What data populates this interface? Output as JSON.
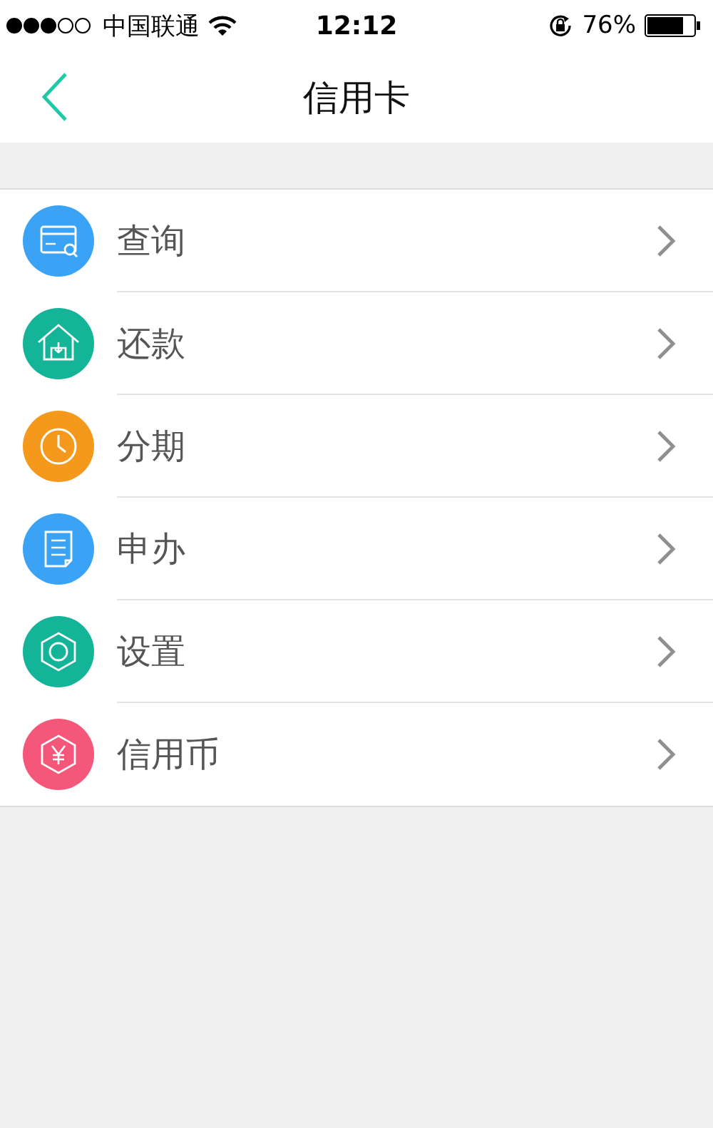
{
  "status_bar": {
    "carrier": "中国联通",
    "time": "12:12",
    "battery": "76%"
  },
  "nav": {
    "title": "信用卡"
  },
  "menu": [
    {
      "label": "查询",
      "kind": "card",
      "color": "#3aa3f5"
    },
    {
      "label": "还款",
      "kind": "house",
      "color": "#13b497"
    },
    {
      "label": "分期",
      "kind": "clock",
      "color": "#f4991c"
    },
    {
      "label": "申办",
      "kind": "document",
      "color": "#3aa3f5"
    },
    {
      "label": "设置",
      "kind": "hexagon",
      "color": "#13b497"
    },
    {
      "label": "信用币",
      "kind": "coin",
      "color": "#f5577a"
    }
  ]
}
